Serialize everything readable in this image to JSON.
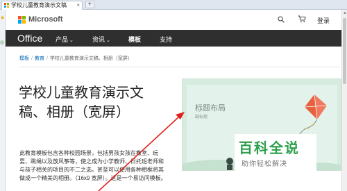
{
  "browser": {
    "tab_title": "学校儿童教育演示文稿",
    "tab_close": "×",
    "new_tab": "+"
  },
  "header": {
    "brand": "Microsoft",
    "signin": "登录"
  },
  "nav": {
    "product_name": "Office",
    "items": [
      {
        "label": "产品",
        "dropdown": true
      },
      {
        "label": "资讯",
        "dropdown": true
      },
      {
        "label": "模板",
        "dropdown": false
      },
      {
        "label": "支持",
        "dropdown": false
      }
    ]
  },
  "breadcrumb": {
    "items": [
      "模板",
      "教育",
      "学校儿童教育演示文稿、相册（宽屏）"
    ]
  },
  "main": {
    "title": "学校儿童教育演示文稿、相册（宽屏）",
    "description": "此教育模板包含各种校园场景，包括男孩女孩在教室、玩耍、跳绳以及放风筝等，使之成为小学教师、日托班老师和与孩子相关的项目的不二之选。甚至可以使用各种相框将其做成一个精美的相册。（16x9 宽屏）。这是一个易访问模板。"
  },
  "thumbnail": {
    "title": "标题布局",
    "subtitle": "副标题"
  },
  "watermark": {
    "main": "百科全说",
    "sub": "助你轻松解决"
  },
  "colors": {
    "nav_bg": "#2f2f2f",
    "link": "#0067b8",
    "watermark_green": "#2b9f4a",
    "arrow_red": "#e0201c",
    "ms_red": "#f25022",
    "ms_green": "#7fba00",
    "ms_blue": "#00a4ef",
    "ms_yellow": "#ffb900"
  },
  "icons": [
    "microsoft-logo",
    "search-icon",
    "cart-icon",
    "chevron-down-icon",
    "star-icon",
    "check-icon"
  ]
}
